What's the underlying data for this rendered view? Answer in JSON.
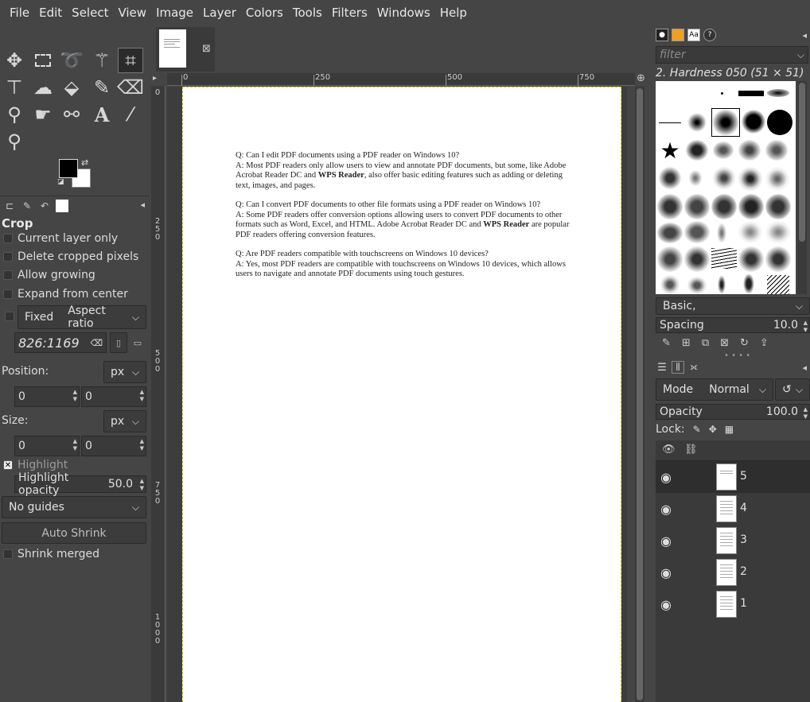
{
  "menu": [
    "File",
    "Edit",
    "Select",
    "View",
    "Image",
    "Layer",
    "Colors",
    "Tools",
    "Filters",
    "Windows",
    "Help"
  ],
  "tool_options": {
    "title": "Crop",
    "current_layer_only": "Current layer only",
    "delete_cropped_pixels": "Delete cropped pixels",
    "allow_growing": "Allow growing",
    "expand_from_center": "Expand from center",
    "fixed_label": "Fixed",
    "fixed_mode": "Aspect ratio",
    "ratio_value": "826:1169",
    "position_label": "Position:",
    "position_unit": "px",
    "position_x": "0",
    "position_y": "0",
    "size_label": "Size:",
    "size_unit": "px",
    "size_w": "0",
    "size_h": "0",
    "highlight": "Highlight",
    "highlight_opacity_label": "Highlight opacity",
    "highlight_opacity_value": "50.0",
    "guides": "No guides",
    "auto_shrink": "Auto Shrink",
    "shrink_merged": "Shrink merged"
  },
  "ruler": {
    "h_labels": [
      "0",
      "250",
      "500",
      "750"
    ],
    "v_labels": [
      "0",
      "250",
      "500",
      "750",
      "1000"
    ]
  },
  "document": {
    "qa1_q": "Q: Can I edit PDF documents using a PDF reader on Windows 10?",
    "qa1_a_pre": "A: Most PDF readers only allow users to view and annotate PDF documents, but some, like Adobe Acrobat Reader DC and ",
    "qa1_a_bold": "WPS Reader",
    "qa1_a_post": ", also offer basic editing features such as adding or deleting text, images, and pages.",
    "qa2_q": "Q: Can I convert PDF documents to other file formats using a PDF reader on Windows 10?",
    "qa2_a_pre": "A: Some PDF readers offer conversion options allowing users to convert PDF documents to other formats such as Word, Excel, and HTML. Adobe Acrobat Reader DC and ",
    "qa2_a_bold": "WPS Reader",
    "qa2_a_post": " are popular PDF readers offering conversion features.",
    "qa3_q": "Q: Are PDF readers compatible with touchscreens on Windows 10 devices?",
    "qa3_a": "A: Yes, most PDF readers are compatible with touchscreens on Windows 10 devices, which allows users to navigate and annotate PDF documents using touch gestures."
  },
  "brushes": {
    "filter_placeholder": "filter",
    "selected_brush": "2. Hardness 050 (51 × 51)",
    "preset": "Basic,",
    "spacing_label": "Spacing",
    "spacing_value": "10.0"
  },
  "layers": {
    "mode_label": "Mode",
    "mode_value": "Normal",
    "opacity_label": "Opacity",
    "opacity_value": "100.0",
    "lock_label": "Lock:",
    "items": [
      "5",
      "4",
      "3",
      "2",
      "1"
    ]
  }
}
